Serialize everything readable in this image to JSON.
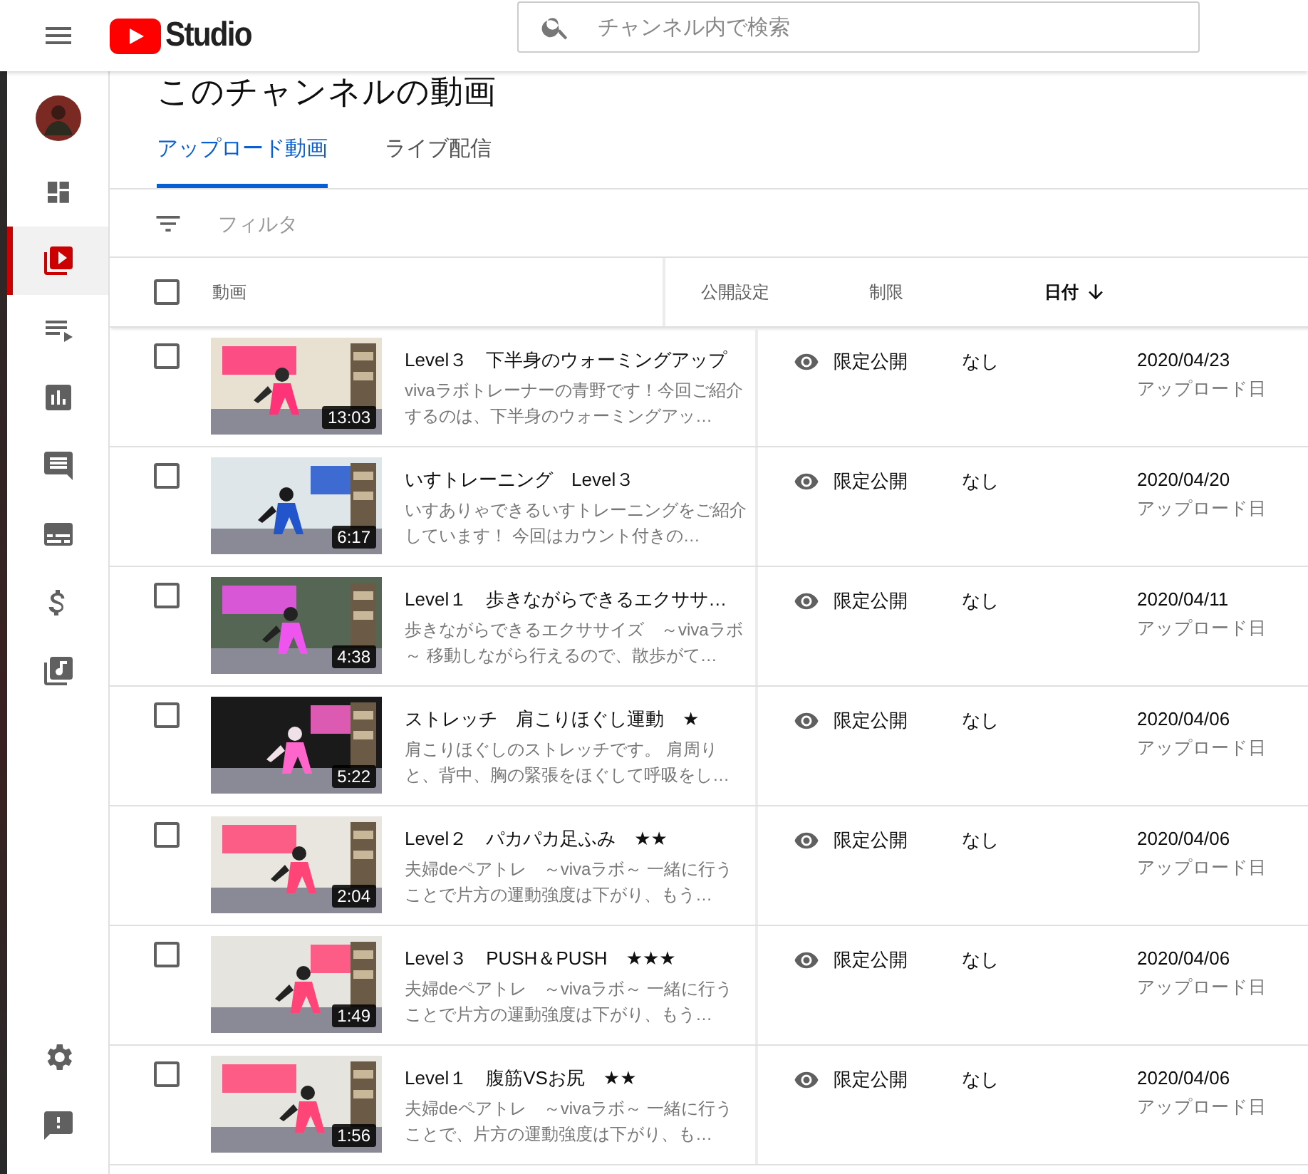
{
  "header": {
    "logo_text": "Studio",
    "search": {
      "placeholder": "チャンネル内で検索"
    }
  },
  "sidebar": {
    "items": [
      {
        "kind": "dashboard",
        "selected": false
      },
      {
        "kind": "videos",
        "selected": true
      },
      {
        "kind": "playlists",
        "selected": false
      },
      {
        "kind": "analytics",
        "selected": false
      },
      {
        "kind": "comments",
        "selected": false
      },
      {
        "kind": "subtitles",
        "selected": false
      },
      {
        "kind": "monetization",
        "selected": false
      },
      {
        "kind": "audio",
        "selected": false
      }
    ],
    "bottom_items": [
      {
        "kind": "settings",
        "selected": false
      },
      {
        "kind": "feedback",
        "selected": false
      }
    ]
  },
  "page_title": "このチャンネルの動画",
  "tabs": [
    {
      "label": "アップロード動画",
      "selected": true
    },
    {
      "label": "ライブ配信",
      "selected": false
    }
  ],
  "filter": {
    "placeholder": "フィルタ"
  },
  "table": {
    "select_all": {
      "checked": false
    },
    "columns": [
      {
        "label": "動画",
        "sorted": false
      },
      {
        "label": "公開設定",
        "sorted": false
      },
      {
        "label": "制限",
        "sorted": false
      },
      {
        "label": "日付",
        "sorted": true
      }
    ],
    "rows": [
      {
        "checked": false,
        "duration": "13:03",
        "title": "Level３　下半身のウォーミングアップ",
        "description": "vivaラボトレーナーの青野です！今回ご紹介するのは、下半身のウォーミングアッ…",
        "visibility": "限定公開",
        "restriction": "なし",
        "date": "2020/04/23",
        "date_label": "アップロード日"
      },
      {
        "checked": false,
        "duration": "6:17",
        "title": "いすトレーニング　Level３",
        "description": "いすありゃできるいすトレーニングをご紹介しています！ 今回はカウント付きの…",
        "visibility": "限定公開",
        "restriction": "なし",
        "date": "2020/04/20",
        "date_label": "アップロード日"
      },
      {
        "checked": false,
        "duration": "4:38",
        "title": "Level１　歩きながらできるエクササ…",
        "description": "歩きながらできるエクササイズ　～vivaラボ～ 移動しながら行えるので、散歩がて…",
        "visibility": "限定公開",
        "restriction": "なし",
        "date": "2020/04/11",
        "date_label": "アップロード日"
      },
      {
        "checked": false,
        "duration": "5:22",
        "title": "ストレッチ　肩こりほぐし運動　★",
        "description": "肩こりほぐしのストレッチです。 肩周りと、背中、胸の緊張をほぐして呼吸をし…",
        "visibility": "限定公開",
        "restriction": "なし",
        "date": "2020/04/06",
        "date_label": "アップロード日"
      },
      {
        "checked": false,
        "duration": "2:04",
        "title": "Level２　パカパカ足ふみ　★★",
        "description": "夫婦deペアトレ　～vivaラボ～ 一緒に行うことで片方の運動強度は下がり、もう…",
        "visibility": "限定公開",
        "restriction": "なし",
        "date": "2020/04/06",
        "date_label": "アップロード日"
      },
      {
        "checked": false,
        "duration": "1:49",
        "title": "Level３　PUSH＆PUSH　★★★",
        "description": "夫婦deペアトレ　～vivaラボ～ 一緒に行うことで片方の運動強度は下がり、もう…",
        "visibility": "限定公開",
        "restriction": "なし",
        "date": "2020/04/06",
        "date_label": "アップロード日"
      },
      {
        "checked": false,
        "duration": "1:56",
        "title": "Level１　腹筋VSお尻　★★",
        "description": "夫婦deペアトレ　～vivaラボ～ 一緒に行うことで、片方の運動強度は下がり、も…",
        "visibility": "限定公開",
        "restriction": "なし",
        "date": "2020/04/06",
        "date_label": "アップロード日"
      }
    ]
  }
}
